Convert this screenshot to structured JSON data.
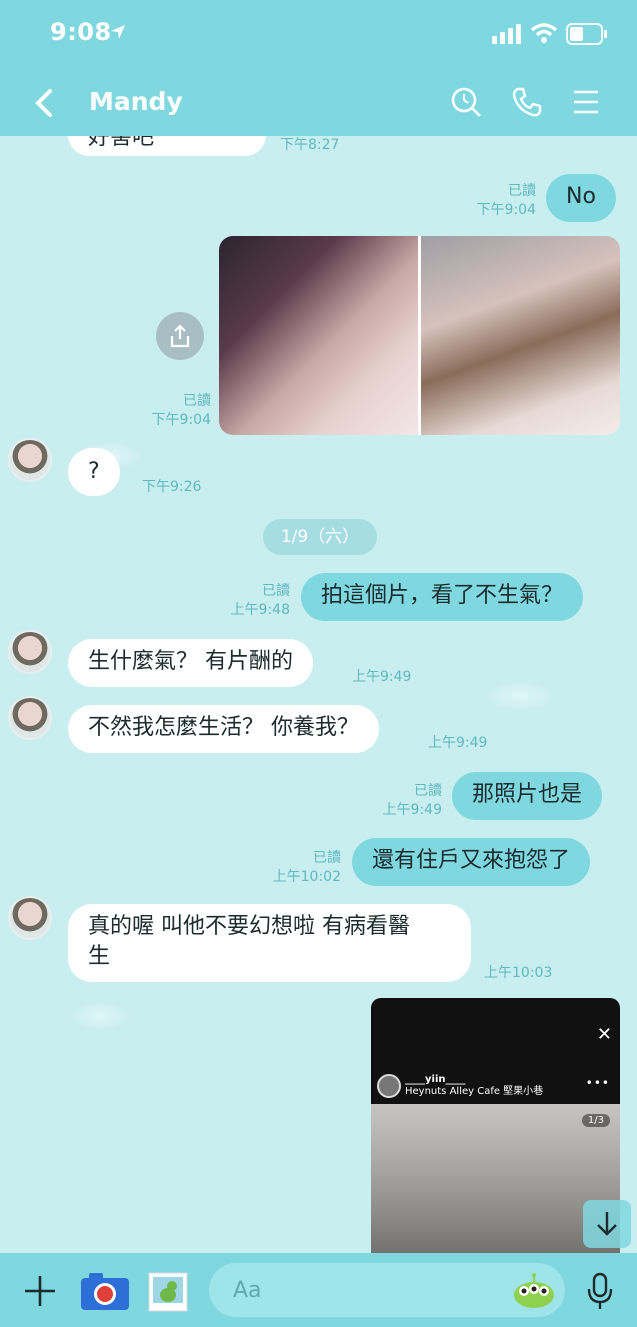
{
  "status": {
    "time": "9:08"
  },
  "header": {
    "title": "Mandy"
  },
  "messages": [
    {
      "id": "m0",
      "text": "好害吧",
      "time": "下午8:27"
    },
    {
      "id": "m1",
      "text": "No",
      "read": "已讀",
      "time": "下午9:04"
    },
    {
      "id": "m2",
      "read": "已讀",
      "time": "下午9:04"
    },
    {
      "id": "m3",
      "text": "?",
      "time": "下午9:26"
    },
    {
      "id": "m4",
      "text": "拍這個片，看了不生氣？",
      "read": "已讀",
      "time": "上午9:48"
    },
    {
      "id": "m5",
      "text": "生什麼氣？ 有片酬的",
      "time": "上午9:49"
    },
    {
      "id": "m6",
      "text": "不然我怎麼生活？ 你養我？",
      "time": "上午9:49"
    },
    {
      "id": "m7",
      "text": "那照片也是",
      "read": "已讀",
      "time": "上午9:49"
    },
    {
      "id": "m8",
      "text": "還有住戶又來抱怨了",
      "read": "已讀",
      "time": "上午10:02"
    },
    {
      "id": "m9",
      "text_line1": "真的喔 叫他不要幻想啦 有病看醫",
      "text_line2": "生",
      "time": "上午10:03"
    }
  ],
  "date_divider": "1/9（六）",
  "story": {
    "username": "____yiin____",
    "location": "Heynuts Alley Cafe 堅果小巷",
    "page": "1/3"
  },
  "composer": {
    "placeholder": "Aa"
  },
  "colors": {
    "accent": "#7fd8df",
    "background": "#c9eef0",
    "meta": "#5fb9c2"
  }
}
